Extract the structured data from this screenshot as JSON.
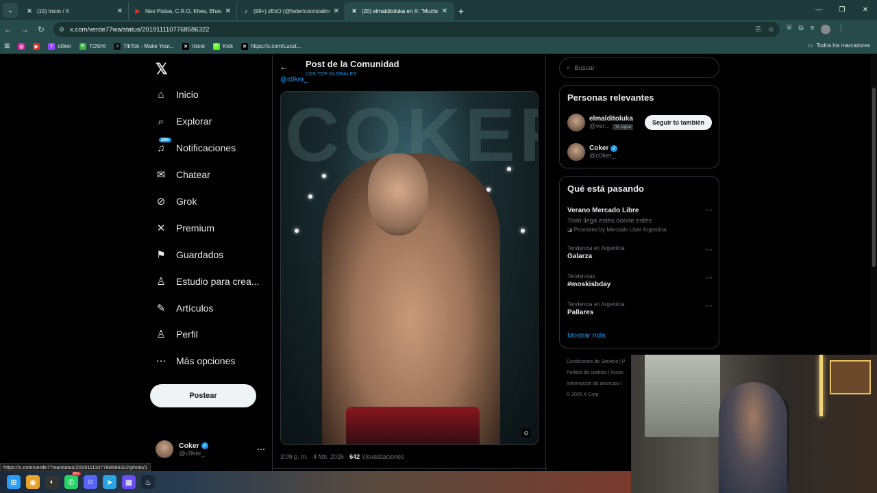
{
  "browser": {
    "tabs": [
      {
        "title": "(15) Inicio / X",
        "favicon": "x-icon",
        "active": false
      },
      {
        "title": "Neo Pistea, C.R.O, Khea, Bhavi",
        "favicon": "youtube-icon",
        "active": false
      },
      {
        "title": "(99+) zEkO (@federicocristalino",
        "favicon": "tiktok-icon",
        "active": false
      },
      {
        "title": "(20) elmalditoluka en X: \"Mucha",
        "favicon": "x-icon",
        "active": true
      }
    ],
    "url": "x.com/verde77wa/status/2019111107768586322",
    "bookmarks": [
      {
        "label": "",
        "icon": "instagram-icon",
        "color": "#d6249f"
      },
      {
        "label": "",
        "icon": "youtube-icon",
        "color": "#e52d27"
      },
      {
        "label": "c0ker",
        "icon": "twitch-icon",
        "color": "#9146ff"
      },
      {
        "label": "TOSHI",
        "icon": "kick-icon",
        "color": "#3cb043"
      },
      {
        "label": "TikTok - Make Your...",
        "icon": "tiktok-icon",
        "color": "#111111"
      },
      {
        "label": "Inicio",
        "icon": "x-icon",
        "color": "#000000"
      },
      {
        "label": "Kick",
        "icon": "kick-icon",
        "color": "#53fc18"
      },
      {
        "label": "https://x.com/Lucst...",
        "icon": "x-icon",
        "color": "#000000"
      }
    ],
    "bookmarks_folder": "Todos los marcadores"
  },
  "nav": {
    "items": [
      {
        "label": "Inicio",
        "icon": "home-icon",
        "glyph": "⌂"
      },
      {
        "label": "Explorar",
        "icon": "search-icon",
        "glyph": "⌕"
      },
      {
        "label": "Notificaciones",
        "icon": "bell-icon",
        "glyph": "♫"
      },
      {
        "label": "Chatear",
        "icon": "mail-icon",
        "glyph": "✉"
      },
      {
        "label": "Grok",
        "icon": "grok-icon",
        "glyph": "⊘"
      },
      {
        "label": "Premium",
        "icon": "x-icon",
        "glyph": "✕"
      },
      {
        "label": "Guardados",
        "icon": "bookmark-icon",
        "glyph": "⚑"
      },
      {
        "label": "Estudio para crea...",
        "icon": "studio-icon",
        "glyph": "♙"
      },
      {
        "label": "Artículos",
        "icon": "article-icon",
        "glyph": "✎"
      },
      {
        "label": "Perfil",
        "icon": "person-icon",
        "glyph": "♙"
      },
      {
        "label": "Más opciones",
        "icon": "more-icon",
        "glyph": "⋯"
      }
    ],
    "notif_badge": "20+",
    "post_button": "Postear",
    "account": {
      "name": "Coker",
      "handle": "@c0ker_"
    }
  },
  "post": {
    "title": "Post de la Comunidad",
    "community": "LOS TOP GLOBALES",
    "handle_partial": "@c0ker_",
    "photo_text": "COKER",
    "time": "3:09 p. m. · 4 feb. 2026 · ",
    "views": "642",
    "views_label": " Visualizaciones"
  },
  "sidebar": {
    "search_placeholder": "Buscar",
    "relevant_title": "Personas relevantes",
    "people": [
      {
        "name": "elmalditoluka",
        "handle": "@ver...",
        "follows_you": "Te sigue",
        "button": "Seguir tú también"
      },
      {
        "name": "Coker",
        "handle": "@c0ker_",
        "verified": true
      }
    ],
    "trending_title": "Qué está pasando",
    "trends": [
      {
        "category": "",
        "title": "Verano Mercado Libre",
        "sub": "Todo llega estés donde estés",
        "promo": "Promoted by Mercado Libre Argentina"
      },
      {
        "category": "Tendencia en Argentina",
        "title": "Galarza"
      },
      {
        "category": "Tendencias",
        "title": "#moskisbday"
      },
      {
        "category": "Tendencia en Argentina",
        "title": "Pallares"
      }
    ],
    "show_more": "Mostrar más",
    "footer": [
      "Condiciones de Servicio  |  P",
      "Política de cookies  |  Acces",
      "Información de anuncios  |",
      "© 2026 X Corp."
    ]
  },
  "status_url": "https://x.com/verde77wa/status/2019111107768586322/photo/1",
  "taskbar": [
    {
      "icon": "windows-icon",
      "badge": ""
    },
    {
      "icon": "chrome-icon",
      "badge": ""
    },
    {
      "icon": "obs-icon",
      "badge": ""
    },
    {
      "icon": "whatsapp-icon",
      "badge": "99+"
    },
    {
      "icon": "discord-icon",
      "badge": ""
    },
    {
      "icon": "telegram-icon",
      "badge": ""
    },
    {
      "icon": "grid-app-icon",
      "badge": ""
    },
    {
      "icon": "steam-icon",
      "badge": ""
    }
  ]
}
